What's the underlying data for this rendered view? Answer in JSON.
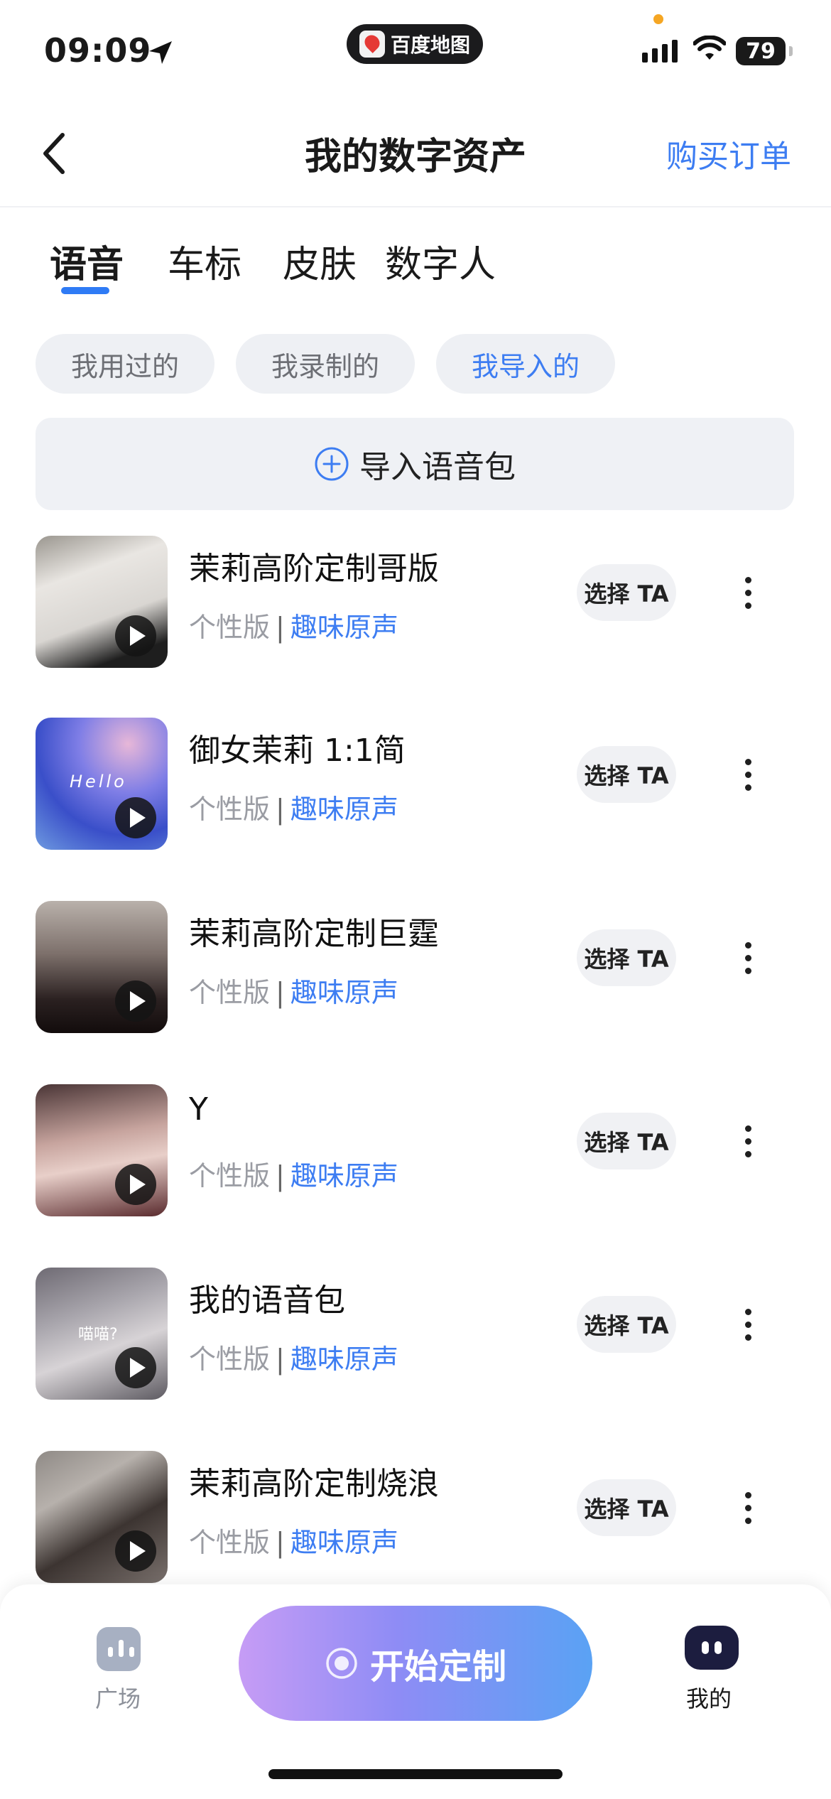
{
  "status_bar": {
    "time": "09:09",
    "app_name": "百度地图",
    "battery": "79"
  },
  "header": {
    "title": "我的数字资产",
    "orders_label": "购买订单"
  },
  "tabs": [
    "语音",
    "车标",
    "皮肤",
    "数字人"
  ],
  "active_tab": "语音",
  "filters": [
    "我用过的",
    "我录制的",
    "我导入的"
  ],
  "active_filter": "我导入的",
  "import_label": "导入语音包",
  "voices": [
    {
      "name": "茉莉高阶定制哥版",
      "type": "个性版",
      "sep": "|",
      "tag": "趣味原声",
      "select": "选择 TA",
      "thumb_caption": ""
    },
    {
      "name": "御女茉莉 1:1简",
      "type": "个性版",
      "sep": "|",
      "tag": "趣味原声",
      "select": "选择 TA",
      "thumb_caption": "Hello"
    },
    {
      "name": "茉莉高阶定制巨霆",
      "type": "个性版",
      "sep": "|",
      "tag": "趣味原声",
      "select": "选择 TA",
      "thumb_caption": ""
    },
    {
      "name": "Y",
      "type": "个性版",
      "sep": "|",
      "tag": "趣味原声",
      "select": "选择 TA",
      "thumb_caption": ""
    },
    {
      "name": "我的语音包",
      "type": "个性版",
      "sep": "|",
      "tag": "趣味原声",
      "select": "选择 TA",
      "thumb_caption": "喵喵?"
    },
    {
      "name": "茉莉高阶定制烧浪",
      "type": "个性版",
      "sep": "|",
      "tag": "趣味原声",
      "select": "选择 TA",
      "thumb_caption": ""
    }
  ],
  "bottom_nav": {
    "plaza_label": "广场",
    "start_label": "开始定制",
    "mine_label": "我的"
  },
  "colors": {
    "accent": "#3d7df2",
    "chip_bg": "#eef0f4",
    "start_gradient_from": "#c69cf5",
    "start_gradient_to": "#5aa2f4"
  }
}
